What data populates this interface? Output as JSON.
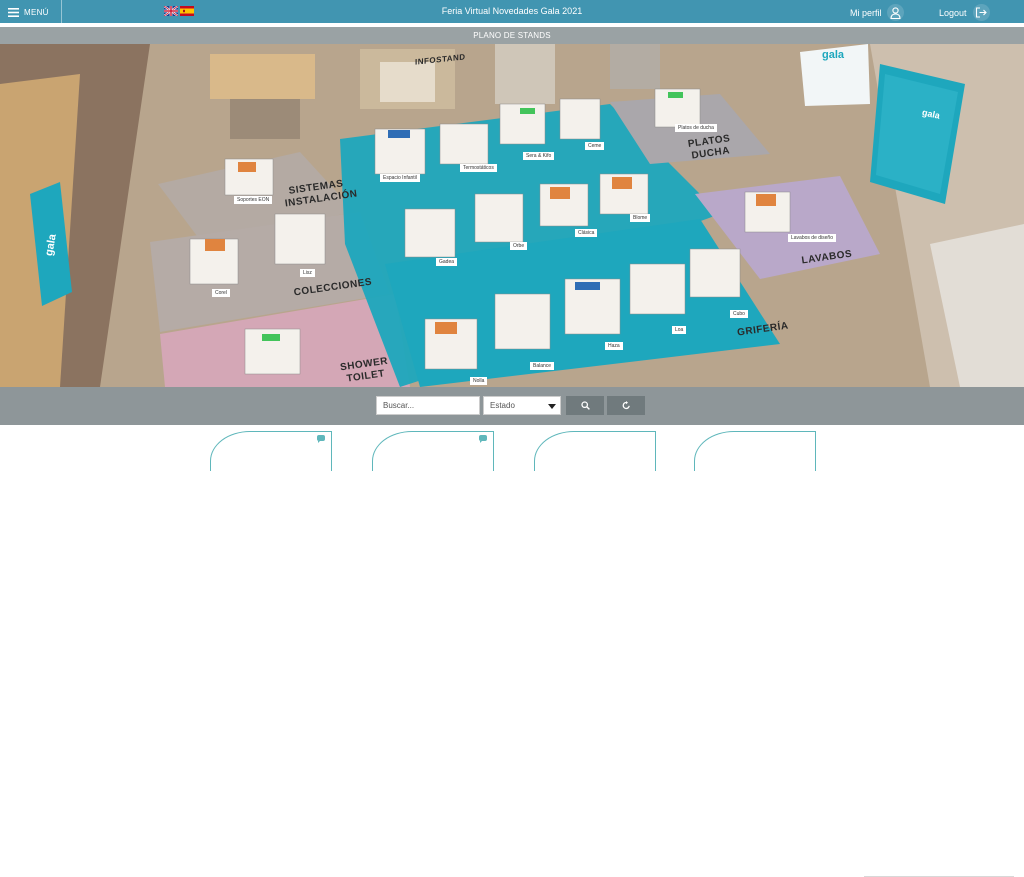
{
  "header": {
    "menu_label": "MENÚ",
    "app_title": "Feria Virtual Novedades Gala 2021",
    "profile_label": "Mi perfil",
    "logout_label": "Logout",
    "languages": [
      "english-flag",
      "spanish-flag"
    ]
  },
  "subheader": {
    "title": "PLANO DE STANDS"
  },
  "map": {
    "banners": [
      "gala",
      "gala",
      "gala"
    ],
    "infostand_label": "INFOSTAND",
    "zones": [
      "PLATOS DUCHA",
      "SISTEMAS INSTALACIÓN",
      "LAVABOS",
      "COLECCIONES",
      "GRIFERÍA",
      "SHOWER TOILET"
    ],
    "stands": [
      "Espacio Infantil",
      "Termostáticos",
      "Sera & Kifo",
      "Ceme",
      "Platos de ducha",
      "Soportes EON",
      "Gadea",
      "Orbe",
      "Clásica",
      "Blome",
      "Lavabos de diseño",
      "Corel",
      "Lisz",
      "Balance",
      "Haza",
      "Loa",
      "Cubo",
      "Nolla"
    ]
  },
  "filters": {
    "search_placeholder": "Buscar...",
    "estado_value": "Estado",
    "search_button_icon": "search-icon",
    "reset_button_icon": "refresh-icon"
  },
  "colors": {
    "topbar": "#4195b1",
    "subbar": "#9aa2a4",
    "filterbar": "#8e9699",
    "accent": "#5fb7bb",
    "zone_teal": "#1ea7bd"
  }
}
